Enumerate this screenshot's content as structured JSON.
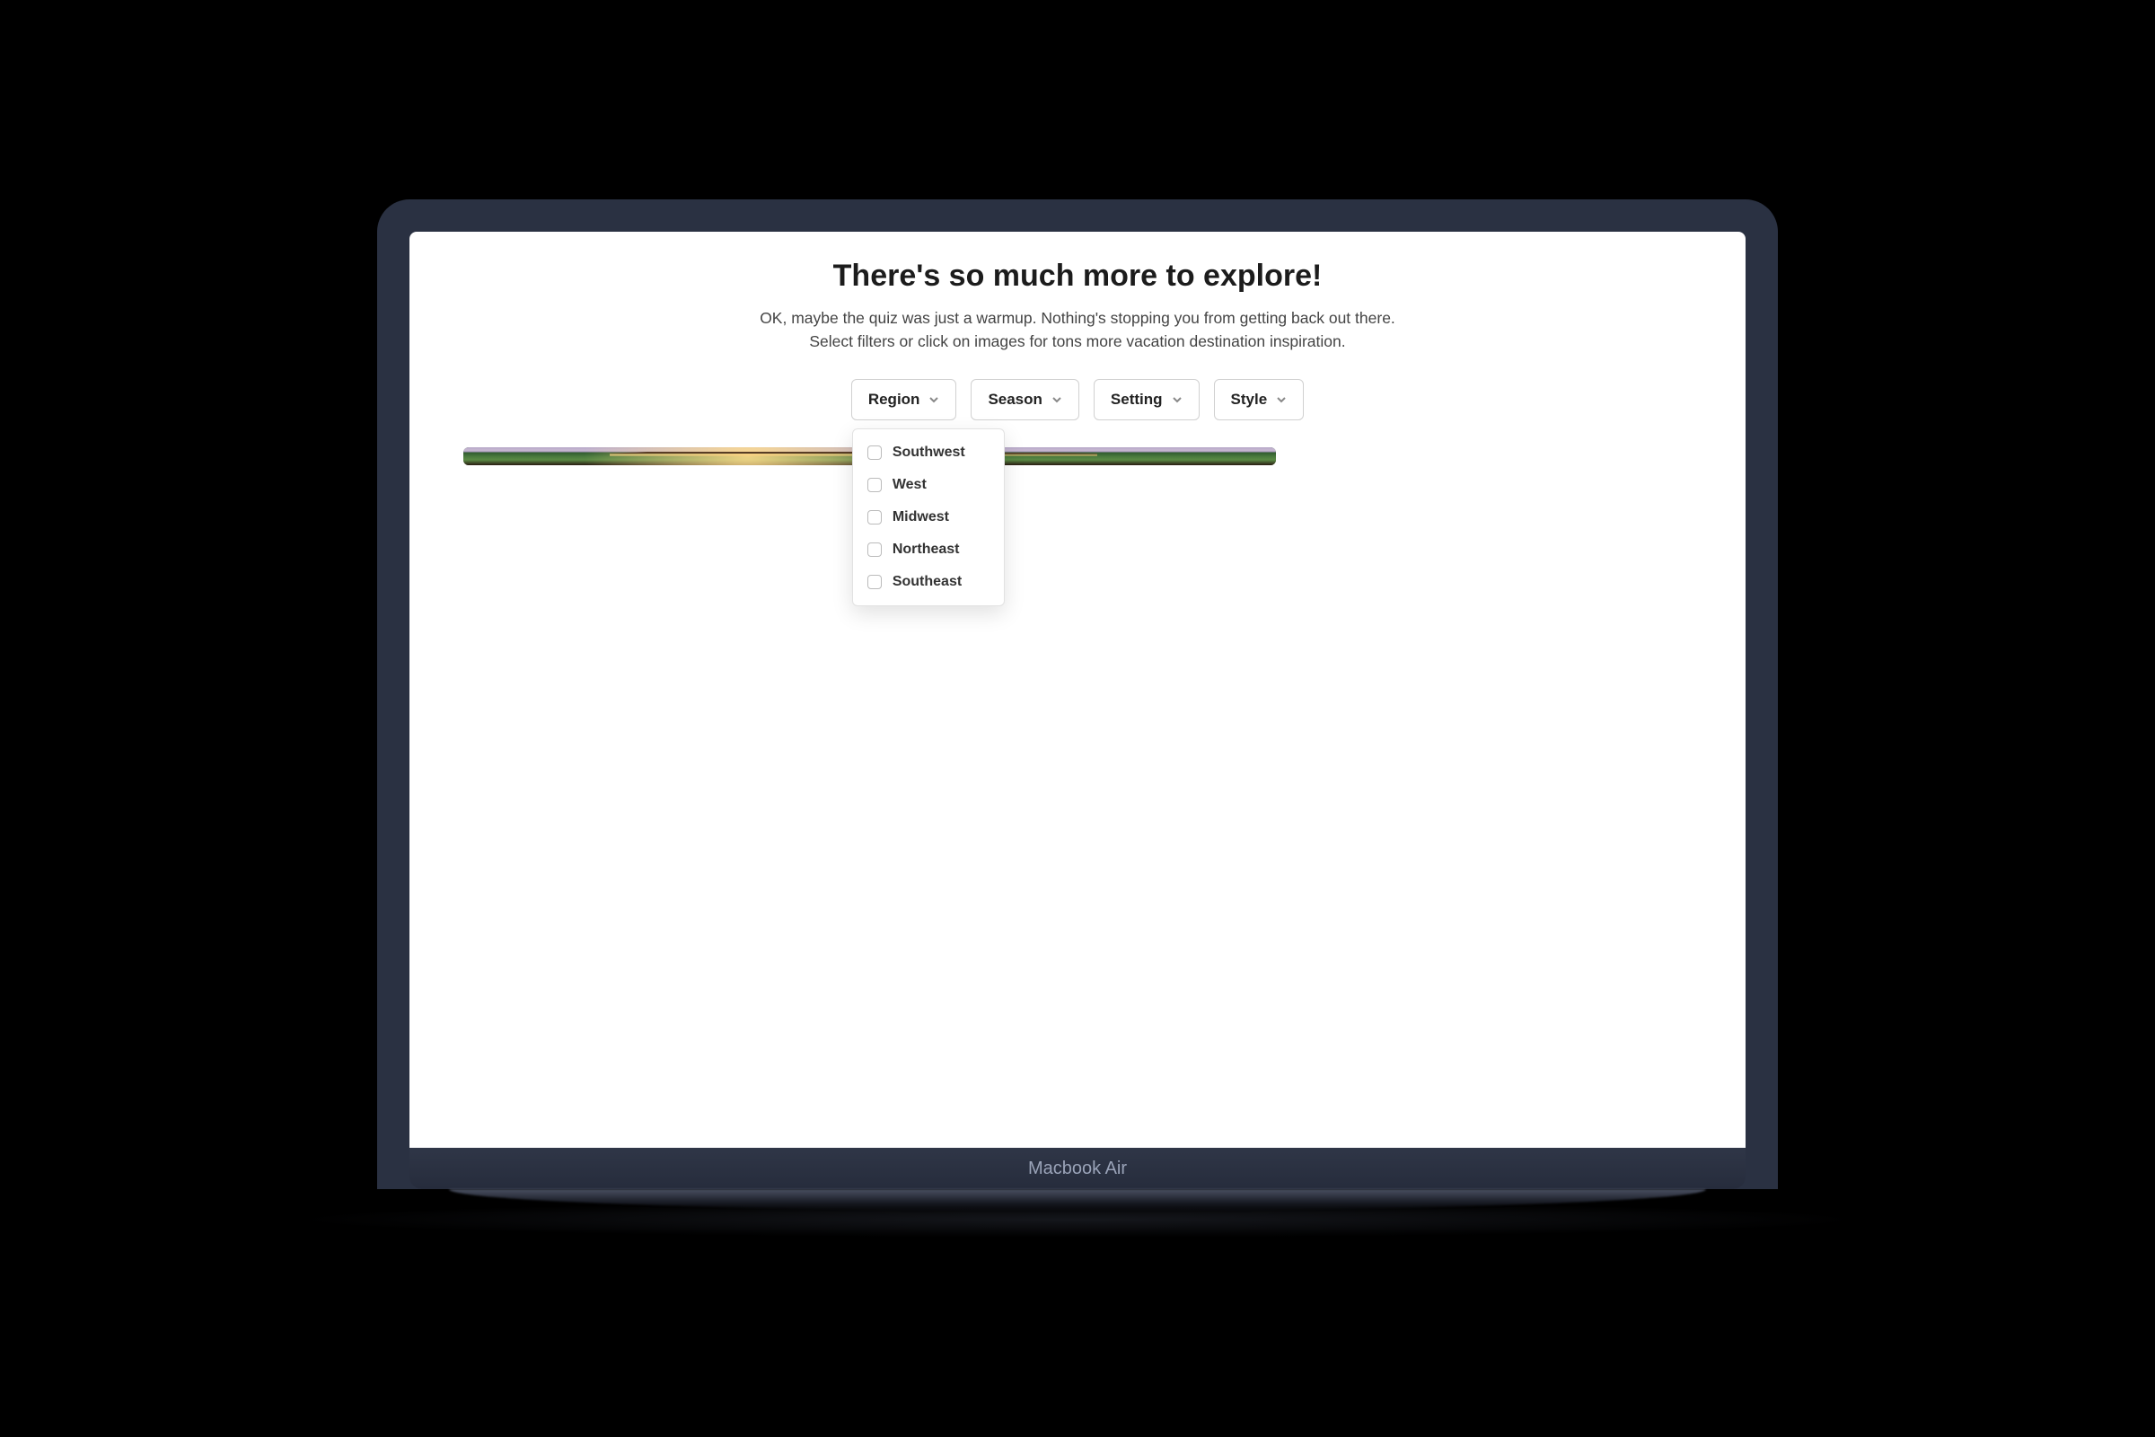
{
  "device": {
    "label": "Macbook Air"
  },
  "page": {
    "heading": "There's so much more to explore!",
    "subheading": "OK, maybe the quiz was just a warmup. Nothing's stopping you from getting back out there. Select filters or click on images for tons more vacation destination inspiration."
  },
  "filters": [
    {
      "label": "Region",
      "open": true
    },
    {
      "label": "Season",
      "open": false
    },
    {
      "label": "Setting",
      "open": false
    },
    {
      "label": "Style",
      "open": false
    }
  ],
  "region_options": [
    {
      "label": "Southwest",
      "checked": false
    },
    {
      "label": "West",
      "checked": false
    },
    {
      "label": "Midwest",
      "checked": false
    },
    {
      "label": "Northeast",
      "checked": false
    },
    {
      "label": "Southeast",
      "checked": false
    }
  ],
  "gallery": [
    {
      "name": "tropical-villa",
      "span": 2
    },
    {
      "name": "fire-pit",
      "span": 1
    },
    {
      "name": "stone-cottage",
      "span": 1
    },
    {
      "name": "forest-cabin",
      "span": 1
    },
    {
      "name": "tree-yard",
      "span": 2
    }
  ]
}
